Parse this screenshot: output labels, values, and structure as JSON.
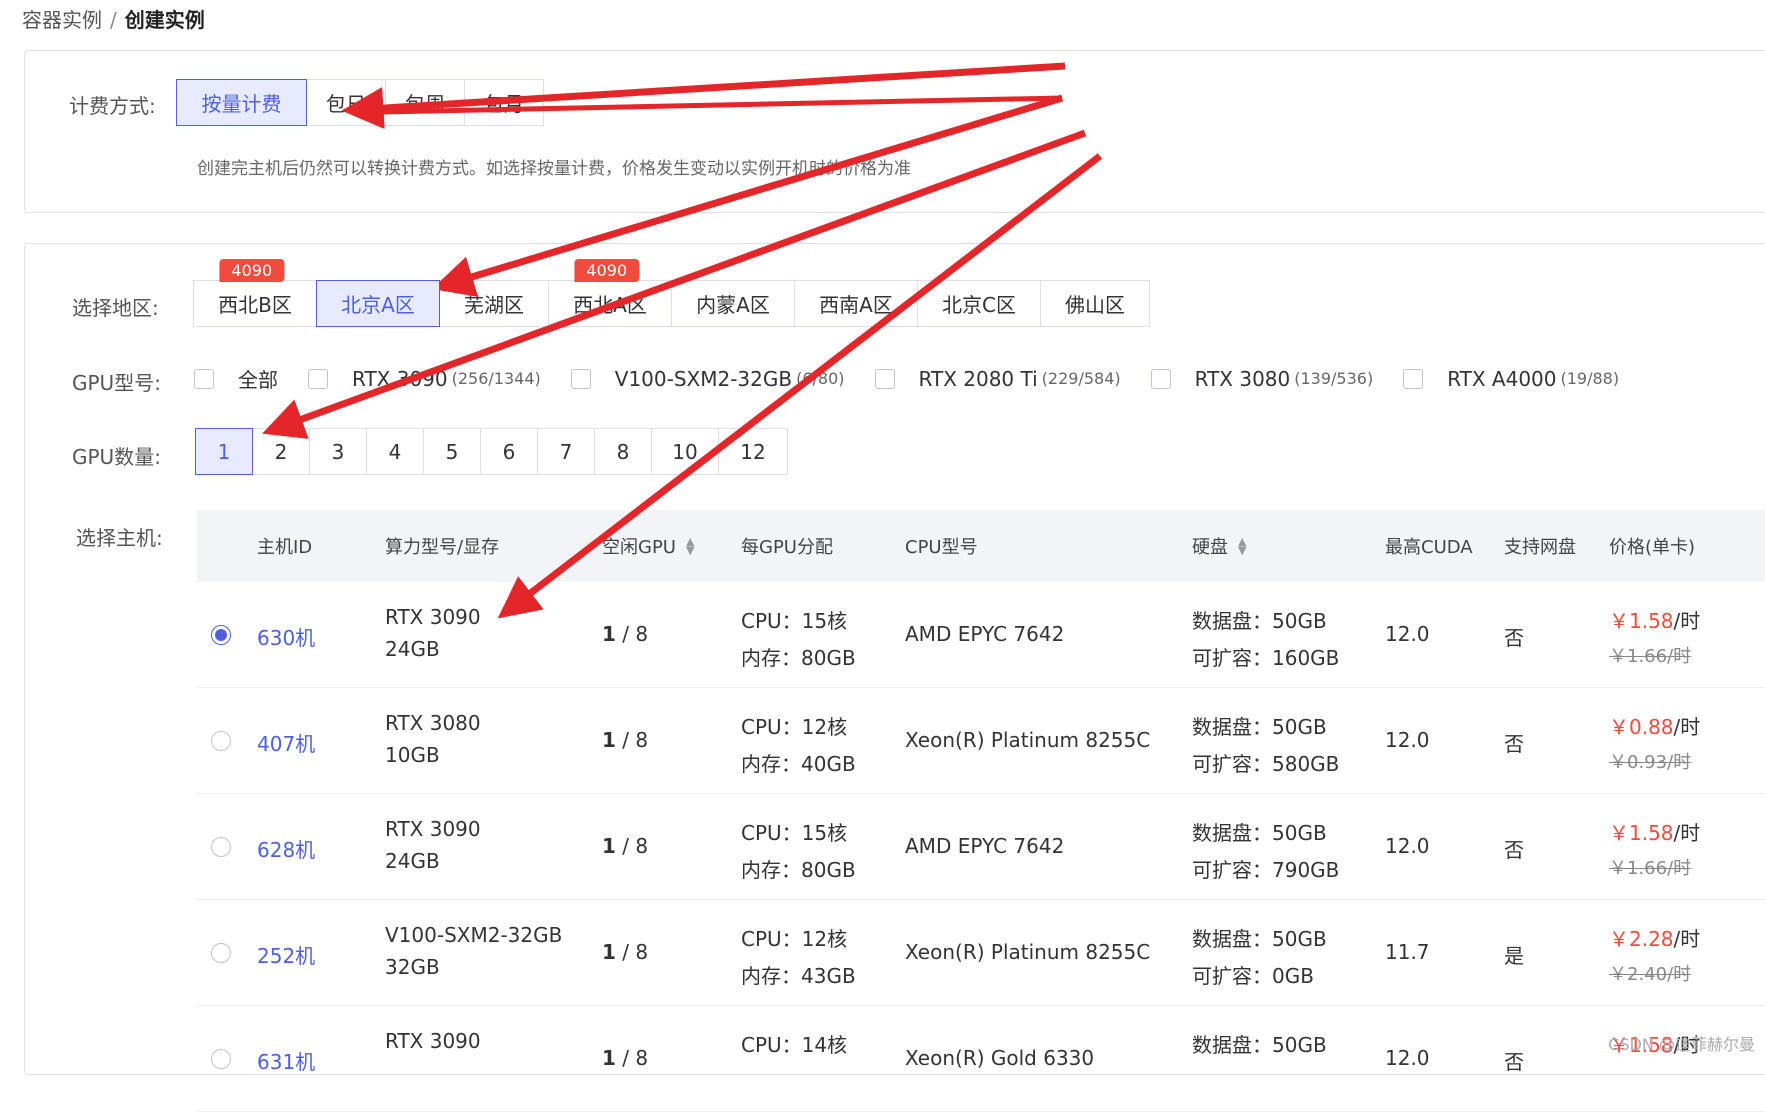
{
  "breadcrumb": {
    "parent": "容器实例",
    "separator": "/",
    "current": "创建实例"
  },
  "billing": {
    "label": "计费方式:",
    "options": [
      "按量计费",
      "包日",
      "包周",
      "包月"
    ],
    "active_index": 0,
    "hint": "创建完主机后仍然可以转换计费方式。如选择按量计费，价格发生变动以实例开机时的价格为准"
  },
  "region": {
    "label": "选择地区:",
    "options": [
      {
        "name": "西北B区",
        "badge": "4090"
      },
      {
        "name": "北京A区",
        "badge": ""
      },
      {
        "name": "芜湖区",
        "badge": ""
      },
      {
        "name": "西北A区",
        "badge": "4090"
      },
      {
        "name": "内蒙A区",
        "badge": ""
      },
      {
        "name": "西南A区",
        "badge": ""
      },
      {
        "name": "北京C区",
        "badge": ""
      },
      {
        "name": "佛山区",
        "badge": ""
      }
    ],
    "active_index": 1
  },
  "gpu_type": {
    "label": "GPU型号:",
    "options": [
      {
        "name": "全部",
        "count": ""
      },
      {
        "name": "RTX 3090",
        "count": "(256/1344)"
      },
      {
        "name": "V100-SXM2-32GB",
        "count": "(6/80)"
      },
      {
        "name": "RTX 2080 Ti",
        "count": "(229/584)"
      },
      {
        "name": "RTX 3080",
        "count": "(139/536)"
      },
      {
        "name": "RTX A4000",
        "count": "(19/88)"
      }
    ]
  },
  "gpu_count": {
    "label": "GPU数量:",
    "options": [
      "1",
      "2",
      "3",
      "4",
      "5",
      "6",
      "7",
      "8",
      "10",
      "12"
    ],
    "active_index": 0
  },
  "host": {
    "label": "选择主机:",
    "columns": [
      "主机ID",
      "算力型号/显存",
      "空闲GPU",
      "每GPU分配",
      "CPU型号",
      "硬盘",
      "最高CUDA",
      "支持网盘",
      "价格(单卡)"
    ],
    "rows": [
      {
        "id": "630机",
        "model": "RTX 3090",
        "vram": "24GB",
        "free": "1",
        "total": "/ 8",
        "cpu": "CPU：15核",
        "mem": "内存：80GB",
        "cpu_model": "AMD EPYC 7642",
        "disk": "数据盘：50GB",
        "expand": "可扩容：160GB",
        "cuda": "12.0",
        "netdisk": "否",
        "price": "￥1.58",
        "unit": "/时",
        "old_price": "￥1.66/时",
        "selected": true
      },
      {
        "id": "407机",
        "model": "RTX 3080",
        "vram": "10GB",
        "free": "1",
        "total": "/ 8",
        "cpu": "CPU：12核",
        "mem": "内存：40GB",
        "cpu_model": "Xeon(R) Platinum 8255C",
        "disk": "数据盘：50GB",
        "expand": "可扩容：580GB",
        "cuda": "12.0",
        "netdisk": "否",
        "price": "￥0.88",
        "unit": "/时",
        "old_price": "￥0.93/时",
        "selected": false
      },
      {
        "id": "628机",
        "model": "RTX 3090",
        "vram": "24GB",
        "free": "1",
        "total": "/ 8",
        "cpu": "CPU：15核",
        "mem": "内存：80GB",
        "cpu_model": "AMD EPYC 7642",
        "disk": "数据盘：50GB",
        "expand": "可扩容：790GB",
        "cuda": "12.0",
        "netdisk": "否",
        "price": "￥1.58",
        "unit": "/时",
        "old_price": "￥1.66/时",
        "selected": false
      },
      {
        "id": "252机",
        "model": "V100-SXM2-32GB",
        "vram": "32GB",
        "free": "1",
        "total": "/ 8",
        "cpu": "CPU：12核",
        "mem": "内存：43GB",
        "cpu_model": "Xeon(R) Platinum 8255C",
        "disk": "数据盘：50GB",
        "expand": "可扩容：0GB",
        "cuda": "11.7",
        "netdisk": "是",
        "price": "￥2.28",
        "unit": "/时",
        "old_price": "￥2.40/时",
        "selected": false
      },
      {
        "id": "631机",
        "model": "RTX 3090",
        "vram": "",
        "free": "1",
        "total": "/ 8",
        "cpu": "CPU：14核",
        "mem": "",
        "cpu_model": "Xeon(R) Gold 6330",
        "disk": "数据盘：50GB",
        "expand": "",
        "cuda": "12.0",
        "netdisk": "否",
        "price": "￥1.58",
        "unit": "/时",
        "old_price": "",
        "selected": false
      }
    ]
  },
  "watermark": "CSDN @迪菲赫尔曼",
  "colors": {
    "accent": "#4e5fe0",
    "price": "#f04b3c",
    "arrow": "#e3262a",
    "badge": "#f04b3c"
  }
}
